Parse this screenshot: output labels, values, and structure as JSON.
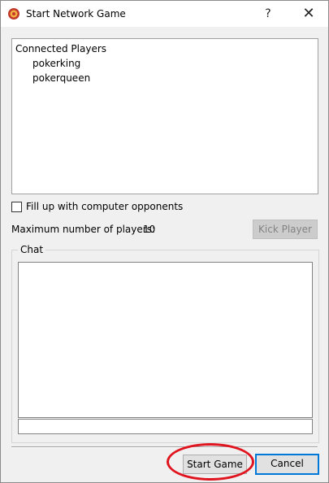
{
  "window": {
    "title": "Start Network Game",
    "help_label": "?",
    "close_label": "✕",
    "icon": "poker-chip-icon"
  },
  "players": {
    "header": "Connected Players",
    "items": [
      "pokerking",
      "pokerqueen"
    ]
  },
  "options": {
    "fill_label": "Fill up with computer opponents",
    "fill_checked": false,
    "max_players_label": "Maximum number of players:",
    "max_players_value": "10",
    "kick_label": "Kick Player"
  },
  "chat": {
    "label": "Chat",
    "messages": [],
    "input_value": ""
  },
  "footer": {
    "start_label": "Start Game",
    "cancel_label": "Cancel"
  },
  "colors": {
    "annotation": "#e0141e",
    "focus_border": "#0078d7"
  }
}
